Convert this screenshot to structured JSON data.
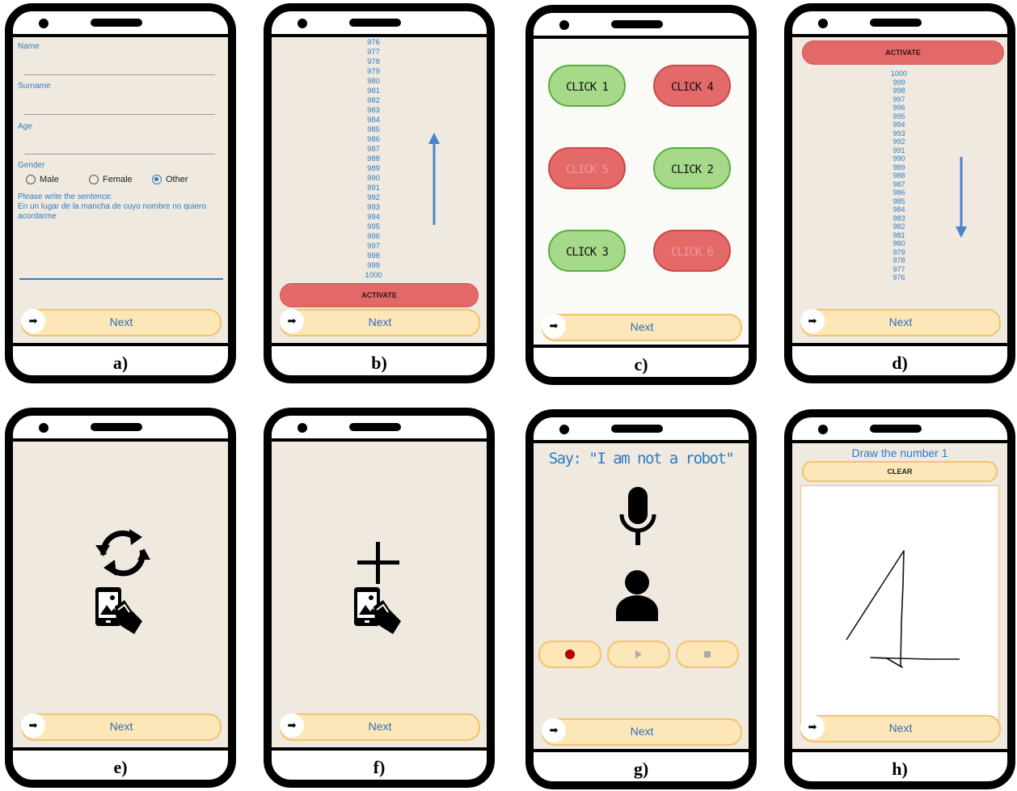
{
  "screens": {
    "a": {
      "label": "a)",
      "fields": [
        "Name",
        "Surname",
        "Age"
      ],
      "gender_label": "Gender",
      "gender_options": [
        "Male",
        "Female",
        "Other"
      ],
      "gender_selected": "Other",
      "sentence_prompt": "Please write the sentence:",
      "sentence": "En un lugar de la mancha de cuyo nombre no quiero acordarme",
      "next": "Next"
    },
    "b": {
      "label": "b)",
      "numbers": [
        "976",
        "977",
        "978",
        "979",
        "980",
        "981",
        "982",
        "983",
        "984",
        "985",
        "986",
        "987",
        "988",
        "989",
        "990",
        "991",
        "992",
        "993",
        "994",
        "995",
        "996",
        "997",
        "998",
        "999",
        "1000"
      ],
      "activate": "ACTIVATE",
      "arrow": "up-arrow-icon",
      "next": "Next"
    },
    "c": {
      "label": "c)",
      "buttons": [
        "CLICK 1",
        "CLICK 4",
        "CLICK 5",
        "CLICK 2",
        "CLICK 3",
        "CLICK 6"
      ],
      "next": "Next"
    },
    "d": {
      "label": "d)",
      "activate": "ACTIVATE",
      "numbers": [
        "1000",
        "999",
        "998",
        "997",
        "996",
        "995",
        "994",
        "993",
        "992",
        "991",
        "990",
        "989",
        "988",
        "987",
        "986",
        "985",
        "984",
        "983",
        "982",
        "981",
        "980",
        "979",
        "978",
        "977",
        "976"
      ],
      "arrow": "down-arrow-icon",
      "next": "Next"
    },
    "e": {
      "label": "e)",
      "icons": [
        "rotate-icon",
        "phone-gallery-hand-icon"
      ],
      "next": "Next"
    },
    "f": {
      "label": "f)",
      "icons": [
        "plus-icon",
        "phone-gallery-hand-icon"
      ],
      "next": "Next"
    },
    "g": {
      "label": "g)",
      "prompt": "Say: \"I am not a robot\"",
      "icons": [
        "microphone-icon",
        "person-icon",
        "record-icon",
        "play-icon",
        "stop-icon"
      ],
      "next": "Next"
    },
    "h": {
      "label": "h)",
      "prompt": "Draw the number 1",
      "clear": "CLEAR",
      "next": "Next"
    }
  },
  "colors": {
    "screen_bg": "#f0e9df",
    "accent_blue": "#2b7cc4",
    "next_bg": "#fde6b8",
    "next_border": "#f1c46b",
    "activate_red": "#e36868",
    "click_green": "#a7d98a",
    "click_red": "#e46a6a"
  }
}
